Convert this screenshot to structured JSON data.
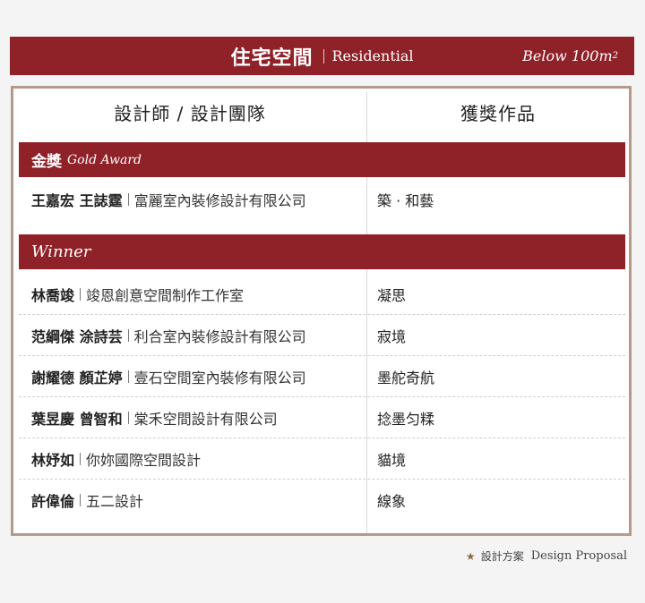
{
  "banner": {
    "title": "住宅空間",
    "subtitle": "Residential",
    "size_text": "Below 100m",
    "size_sup": "2"
  },
  "table": {
    "header_left": "設計師 / 設計團隊",
    "header_right": "獲獎作品"
  },
  "gold": {
    "label_zh": "金獎",
    "label_en": "Gold Award",
    "rows": [
      {
        "person": "王嘉宏 王誌霆",
        "company": "富麗室內裝修設計有限公司",
        "work": "築 · 和藝"
      }
    ]
  },
  "winner": {
    "label_en": "Winner",
    "rows": [
      {
        "person": "林喬竣",
        "company": "竣恩創意空間制作工作室",
        "work": "凝思"
      },
      {
        "person": "范綱傑 涂詩芸",
        "company": "利合室內裝修設計有限公司",
        "work": "寂境"
      },
      {
        "person": "謝耀德 顏芷婷",
        "company": "壹石空間室內裝修有限公司",
        "work": "墨舵奇航"
      },
      {
        "person": "葉昱慶 曾智和",
        "company": "棠禾空間設計有限公司",
        "work": "捻墨匀糅"
      },
      {
        "person": "林妤如",
        "company": "你妳國際空間設計",
        "work": "貓境"
      },
      {
        "person": "許偉倫",
        "company": "五二設計",
        "work": "線象"
      }
    ]
  },
  "footer": {
    "icon": "star-icon",
    "label_zh": "設計方案",
    "label_en": "Design Proposal"
  },
  "colors": {
    "accent": "#8f2128",
    "frame": "#b49a8a",
    "star": "#8a6a44"
  }
}
